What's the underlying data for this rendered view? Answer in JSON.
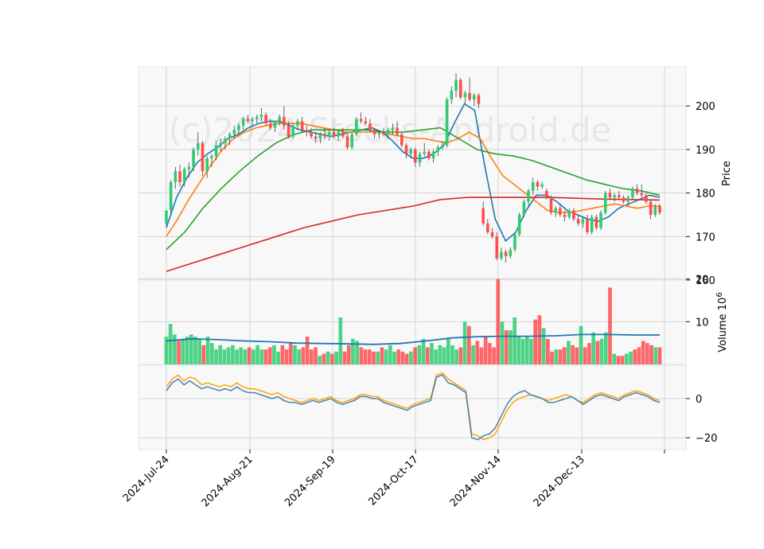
{
  "chart_data": {
    "type": "candlestick",
    "watermark": "(c)2024 Stocks-Android.de",
    "date_ticks": [
      "2024-Jul-24",
      "2024-Aug-21",
      "2024-Sep-19",
      "2024-Oct-17",
      "2024-Nov-14",
      "2024-Dec-13"
    ],
    "price_panel": {
      "ylabel": "Price",
      "ylim": [
        160,
        209
      ],
      "yticks": [
        "160",
        "170",
        "180",
        "190",
        "200"
      ],
      "ohlc": [
        [
          173.0,
          176.0,
          172.5,
          176.0
        ],
        [
          176.0,
          183.0,
          175.0,
          182.5
        ],
        [
          182.5,
          186.0,
          181.0,
          185.0
        ],
        [
          185.0,
          186.5,
          181.5,
          182.5
        ],
        [
          182.5,
          186.0,
          181.5,
          185.5
        ],
        [
          185.5,
          187.0,
          183.5,
          186.0
        ],
        [
          186.0,
          190.5,
          185.0,
          190.0
        ],
        [
          190.0,
          194.0,
          188.5,
          191.5
        ],
        [
          191.5,
          192.0,
          184.0,
          185.0
        ],
        [
          185.0,
          188.5,
          183.5,
          188.0
        ],
        [
          188.0,
          189.0,
          186.0,
          188.5
        ],
        [
          188.5,
          192.0,
          187.5,
          191.0
        ],
        [
          191.0,
          192.5,
          189.5,
          191.5
        ],
        [
          191.5,
          193.0,
          190.0,
          192.5
        ],
        [
          192.5,
          194.0,
          191.0,
          193.5
        ],
        [
          193.5,
          195.5,
          192.5,
          194.5
        ],
        [
          194.5,
          196.0,
          193.5,
          195.5
        ],
        [
          195.5,
          197.5,
          194.5,
          197.0
        ],
        [
          197.0,
          198.0,
          196.0,
          196.5
        ],
        [
          196.5,
          197.5,
          195.5,
          197.0
        ],
        [
          197.0,
          198.0,
          196.0,
          197.5
        ],
        [
          197.5,
          199.5,
          196.5,
          198.0
        ],
        [
          198.0,
          198.5,
          195.5,
          196.0
        ],
        [
          196.0,
          197.0,
          194.5,
          195.0
        ],
        [
          195.0,
          196.5,
          194.0,
          196.5
        ],
        [
          196.5,
          198.0,
          195.5,
          197.5
        ],
        [
          197.5,
          200.0,
          194.5,
          195.5
        ],
        [
          195.5,
          196.5,
          192.5,
          193.0
        ],
        [
          193.0,
          196.0,
          192.5,
          195.5
        ],
        [
          195.5,
          197.0,
          194.5,
          196.5
        ],
        [
          196.5,
          197.5,
          194.0,
          194.5
        ],
        [
          194.5,
          195.5,
          193.0,
          194.0
        ],
        [
          194.0,
          195.0,
          192.5,
          193.0
        ],
        [
          193.0,
          194.0,
          191.5,
          192.5
        ],
        [
          192.5,
          194.0,
          191.5,
          193.5
        ],
        [
          193.5,
          195.0,
          192.5,
          193.0
        ],
        [
          193.0,
          194.5,
          192.0,
          194.0
        ],
        [
          194.0,
          195.0,
          192.5,
          193.0
        ],
        [
          193.0,
          194.5,
          192.0,
          194.0
        ],
        [
          194.0,
          195.0,
          192.5,
          193.0
        ],
        [
          193.0,
          193.5,
          190.0,
          190.5
        ],
        [
          190.5,
          194.0,
          190.0,
          193.5
        ],
        [
          193.5,
          197.5,
          193.0,
          197.0
        ],
        [
          197.0,
          198.5,
          196.0,
          196.5
        ],
        [
          196.5,
          197.5,
          195.5,
          196.0
        ],
        [
          196.0,
          197.0,
          194.0,
          194.5
        ],
        [
          194.5,
          195.0,
          192.5,
          193.5
        ],
        [
          193.5,
          194.5,
          192.5,
          194.0
        ],
        [
          194.0,
          195.0,
          193.0,
          193.5
        ],
        [
          193.5,
          195.0,
          192.5,
          194.5
        ],
        [
          194.5,
          196.0,
          193.5,
          195.0
        ],
        [
          195.0,
          196.5,
          193.0,
          193.5
        ],
        [
          193.5,
          194.0,
          190.5,
          191.0
        ],
        [
          191.0,
          191.5,
          188.0,
          189.0
        ],
        [
          189.0,
          190.5,
          188.0,
          190.0
        ],
        [
          190.0,
          190.5,
          186.0,
          187.0
        ],
        [
          187.0,
          189.5,
          186.0,
          189.0
        ],
        [
          189.0,
          191.5,
          188.5,
          189.5
        ],
        [
          189.5,
          190.0,
          187.5,
          188.0
        ],
        [
          188.0,
          190.0,
          187.0,
          189.5
        ],
        [
          189.5,
          191.0,
          188.5,
          190.5
        ],
        [
          190.5,
          192.0,
          190.0,
          191.0
        ],
        [
          191.0,
          202.0,
          190.5,
          201.5
        ],
        [
          201.5,
          204.5,
          200.5,
          203.5
        ],
        [
          203.5,
          207.5,
          202.0,
          206.0
        ],
        [
          206.0,
          206.5,
          201.5,
          202.0
        ],
        [
          202.0,
          203.5,
          200.5,
          203.0
        ],
        [
          203.0,
          206.5,
          201.0,
          201.5
        ],
        [
          201.5,
          203.0,
          200.0,
          202.5
        ],
        [
          202.5,
          203.0,
          199.5,
          200.5
        ],
        [
          176.5,
          178.0,
          172.5,
          173.0
        ],
        [
          173.0,
          174.0,
          170.5,
          171.0
        ],
        [
          171.0,
          172.0,
          169.5,
          170.0
        ],
        [
          170.0,
          171.0,
          164.5,
          165.0
        ],
        [
          165.0,
          167.5,
          164.5,
          166.5
        ],
        [
          166.5,
          167.0,
          164.0,
          165.5
        ],
        [
          165.5,
          167.5,
          165.0,
          167.0
        ],
        [
          167.0,
          171.0,
          166.5,
          170.5
        ],
        [
          170.5,
          175.5,
          170.0,
          175.0
        ],
        [
          175.0,
          178.5,
          174.5,
          178.0
        ],
        [
          178.0,
          181.0,
          177.0,
          180.5
        ],
        [
          180.5,
          183.5,
          179.5,
          182.5
        ],
        [
          182.5,
          183.0,
          180.5,
          181.5
        ],
        [
          181.5,
          182.5,
          181.0,
          182.0
        ],
        [
          180.5,
          181.0,
          178.5,
          179.0
        ],
        [
          179.0,
          179.5,
          175.0,
          175.5
        ],
        [
          175.5,
          177.0,
          174.5,
          176.5
        ],
        [
          176.5,
          177.5,
          174.5,
          175.0
        ],
        [
          175.0,
          176.0,
          173.5,
          174.5
        ],
        [
          174.5,
          176.5,
          174.0,
          176.0
        ],
        [
          176.0,
          176.5,
          173.5,
          174.0
        ],
        [
          174.0,
          175.0,
          172.5,
          173.0
        ],
        [
          173.0,
          174.5,
          172.0,
          174.0
        ],
        [
          174.0,
          175.0,
          170.5,
          171.0
        ],
        [
          171.0,
          175.0,
          170.5,
          174.5
        ],
        [
          174.5,
          175.0,
          171.5,
          172.0
        ],
        [
          172.0,
          176.0,
          171.5,
          175.5
        ],
        [
          175.5,
          180.5,
          175.0,
          180.0
        ],
        [
          180.0,
          181.0,
          178.5,
          179.0
        ],
        [
          179.0,
          180.0,
          178.0,
          179.5
        ],
        [
          179.5,
          180.5,
          178.5,
          179.0
        ],
        [
          179.0,
          179.5,
          177.5,
          178.0
        ],
        [
          178.0,
          179.5,
          177.0,
          179.0
        ],
        [
          179.0,
          181.5,
          178.5,
          181.0
        ],
        [
          181.0,
          182.0,
          179.5,
          180.0
        ],
        [
          180.0,
          182.0,
          179.0,
          179.5
        ],
        [
          179.5,
          180.0,
          177.5,
          178.0
        ],
        [
          178.0,
          178.5,
          174.0,
          175.0
        ],
        [
          175.0,
          177.5,
          174.5,
          177.0
        ],
        [
          177.0,
          177.5,
          175.0,
          175.5
        ]
      ],
      "series": [
        {
          "color": "#1f77b4",
          "values": [
            172.0,
            179.0,
            183.5,
            187.0,
            189.0,
            190.5,
            192.5,
            193.5,
            195.0,
            196.0,
            196.5,
            196.5,
            195.5,
            194.5,
            194.0,
            193.5,
            193.0,
            193.5,
            194.0,
            194.5,
            195.0,
            194.0,
            192.0,
            189.5,
            188.0,
            188.0,
            189.0,
            191.0,
            196.0,
            200.5,
            199.0,
            186.0,
            174.0,
            169.0,
            171.0,
            176.0,
            179.5,
            179.5,
            178.0,
            176.0,
            175.0,
            174.0,
            173.5,
            174.5,
            176.5,
            177.5,
            178.5,
            179.5,
            179.0
          ]
        },
        {
          "color": "#ff7f0e",
          "values": [
            170.0,
            174.0,
            178.5,
            182.5,
            186.5,
            190.0,
            192.5,
            194.0,
            195.0,
            195.5,
            196.0,
            196.0,
            196.0,
            195.5,
            195.0,
            194.5,
            194.0,
            194.0,
            194.0,
            194.0,
            193.5,
            193.0,
            192.5,
            192.5,
            192.0,
            191.5,
            192.5,
            194.0,
            192.5,
            188.0,
            184.0,
            182.0,
            180.0,
            178.0,
            176.0,
            175.5,
            175.5,
            176.0,
            176.5,
            177.0,
            177.5,
            177.0,
            176.5,
            177.0,
            177.0
          ]
        },
        {
          "color": "#2ca02c",
          "values": [
            167.0,
            171.0,
            176.5,
            181.0,
            185.0,
            188.5,
            191.5,
            193.5,
            194.5,
            194.5,
            194.5,
            194.5,
            194.0,
            194.0,
            194.5,
            195.0,
            192.5,
            190.0,
            189.0,
            188.5,
            187.5,
            186.0,
            184.5,
            183.0,
            182.0,
            181.0,
            180.5,
            179.5
          ]
        },
        {
          "color": "#d62728",
          "values": [
            162.0,
            164.0,
            166.0,
            168.0,
            170.0,
            172.0,
            173.5,
            175.0,
            176.0,
            177.0,
            178.5,
            179.0,
            179.0,
            179.0,
            179.0,
            178.8,
            178.6,
            178.5,
            178.4
          ]
        }
      ]
    },
    "volume_panel": {
      "ylabel": "Volume  10",
      "ylabel_exponent": "6",
      "yticks": [
        "10",
        "20"
      ],
      "ylim": [
        0,
        19
      ],
      "up_color": "#2ecc71",
      "down_color": "#ff4d4d",
      "volumes": [
        6.5,
        9.5,
        7.0,
        5.5,
        6.0,
        6.5,
        7.0,
        6.5,
        6.0,
        4.5,
        6.5,
        5.0,
        3.5,
        4.5,
        3.5,
        4.0,
        4.5,
        3.5,
        4.0,
        3.5,
        4.0,
        3.5,
        4.5,
        3.5,
        3.5,
        4.0,
        4.5,
        3.0,
        4.5,
        3.5,
        5.0,
        4.5,
        3.5,
        4.0,
        6.5,
        3.5,
        4.0,
        2.0,
        2.5,
        3.0,
        2.5,
        3.0,
        11.0,
        3.0,
        4.5,
        6.0,
        5.5,
        4.0,
        3.5,
        3.5,
        3.0,
        3.0,
        4.0,
        3.5,
        4.5,
        3.0,
        3.5,
        3.0,
        2.5,
        3.0,
        4.0,
        4.5,
        6.0,
        4.0,
        5.0,
        3.5,
        4.5,
        4.0,
        6.0,
        4.5,
        3.5,
        4.0,
        10.0,
        9.0,
        4.5,
        5.5,
        4.0,
        6.5,
        5.0,
        4.0,
        20.0,
        10.0,
        8.0,
        8.0,
        11.0,
        6.5,
        6.0,
        6.5,
        6.0,
        10.5,
        11.5,
        8.5,
        6.0,
        3.0,
        3.5,
        3.5,
        4.0,
        5.5,
        4.5,
        4.0,
        9.0,
        4.0,
        5.0,
        7.5,
        5.5,
        6.0,
        7.5,
        18.0,
        2.5,
        2.0,
        2.0,
        2.5,
        3.0,
        3.5,
        4.0,
        5.5,
        5.0,
        4.5,
        4.0,
        4.0
      ],
      "ma": [
        5.5,
        6.0,
        5.8,
        5.5,
        5.3,
        5.0,
        4.9,
        4.8,
        4.7,
        4.9,
        5.5,
        6.2,
        6.5,
        6.6,
        6.6,
        6.7,
        7.0,
        7.0,
        6.9,
        6.9
      ]
    },
    "oscillator_panel": {
      "yticks": [
        "−20",
        "0"
      ],
      "ylim": [
        -26,
        17
      ],
      "series": [
        {
          "color": "#ffa500",
          "values": [
            6,
            10,
            12,
            9,
            11,
            10,
            7,
            8,
            7,
            6,
            7,
            6,
            8,
            6,
            5,
            5,
            4,
            3,
            2,
            3,
            1,
            0,
            -1,
            -2,
            -1,
            0,
            -1,
            0,
            1,
            -1,
            -2,
            -1,
            0,
            2,
            2,
            1,
            1,
            -1,
            -2,
            -3,
            -4,
            -5,
            -3,
            -2,
            -1,
            0,
            12,
            13,
            10,
            8,
            6,
            4,
            -18,
            -19,
            -21,
            -20,
            -18,
            -12,
            -6,
            -2,
            0,
            1,
            2,
            1,
            0,
            -1,
            0,
            1,
            2,
            1,
            -1,
            -2,
            0,
            2,
            3,
            2,
            1,
            0,
            2,
            3,
            4,
            3,
            2,
            0,
            -1
          ]
        },
        {
          "color": "#4682b4",
          "values": [
            4,
            8,
            10,
            7,
            9,
            7,
            5,
            6,
            5,
            4,
            5,
            4,
            6,
            4,
            3,
            3,
            2,
            1,
            0,
            1,
            -1,
            -2,
            -2,
            -3,
            -2,
            -1,
            -2,
            -1,
            0,
            -2,
            -3,
            -2,
            -1,
            1,
            1,
            0,
            0,
            -2,
            -3,
            -4,
            -5,
            -6,
            -4,
            -3,
            -2,
            -1,
            11,
            12,
            8,
            7,
            5,
            3,
            -20,
            -21,
            -19,
            -18,
            -15,
            -9,
            -3,
            1,
            3,
            4,
            2,
            1,
            0,
            -2,
            -2,
            -1,
            0,
            1,
            -1,
            -3,
            -1,
            1,
            2,
            1,
            0,
            -1,
            1,
            2,
            3,
            2,
            1,
            -1,
            -2
          ]
        }
      ]
    }
  }
}
